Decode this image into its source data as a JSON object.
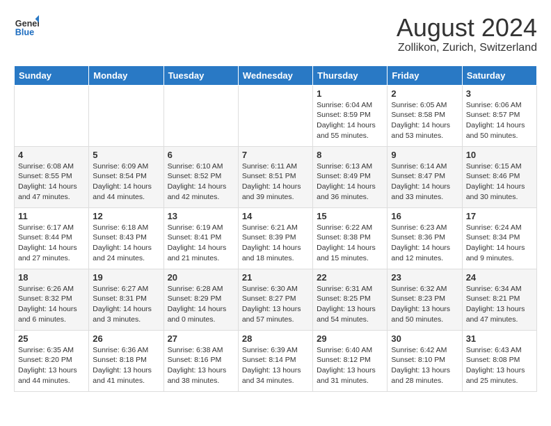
{
  "header": {
    "logo_line1": "General",
    "logo_line2": "Blue",
    "month_year": "August 2024",
    "location": "Zollikon, Zurich, Switzerland"
  },
  "days_of_week": [
    "Sunday",
    "Monday",
    "Tuesday",
    "Wednesday",
    "Thursday",
    "Friday",
    "Saturday"
  ],
  "weeks": [
    [
      {
        "num": "",
        "info": ""
      },
      {
        "num": "",
        "info": ""
      },
      {
        "num": "",
        "info": ""
      },
      {
        "num": "",
        "info": ""
      },
      {
        "num": "1",
        "info": "Sunrise: 6:04 AM\nSunset: 8:59 PM\nDaylight: 14 hours\nand 55 minutes."
      },
      {
        "num": "2",
        "info": "Sunrise: 6:05 AM\nSunset: 8:58 PM\nDaylight: 14 hours\nand 53 minutes."
      },
      {
        "num": "3",
        "info": "Sunrise: 6:06 AM\nSunset: 8:57 PM\nDaylight: 14 hours\nand 50 minutes."
      }
    ],
    [
      {
        "num": "4",
        "info": "Sunrise: 6:08 AM\nSunset: 8:55 PM\nDaylight: 14 hours\nand 47 minutes."
      },
      {
        "num": "5",
        "info": "Sunrise: 6:09 AM\nSunset: 8:54 PM\nDaylight: 14 hours\nand 44 minutes."
      },
      {
        "num": "6",
        "info": "Sunrise: 6:10 AM\nSunset: 8:52 PM\nDaylight: 14 hours\nand 42 minutes."
      },
      {
        "num": "7",
        "info": "Sunrise: 6:11 AM\nSunset: 8:51 PM\nDaylight: 14 hours\nand 39 minutes."
      },
      {
        "num": "8",
        "info": "Sunrise: 6:13 AM\nSunset: 8:49 PM\nDaylight: 14 hours\nand 36 minutes."
      },
      {
        "num": "9",
        "info": "Sunrise: 6:14 AM\nSunset: 8:47 PM\nDaylight: 14 hours\nand 33 minutes."
      },
      {
        "num": "10",
        "info": "Sunrise: 6:15 AM\nSunset: 8:46 PM\nDaylight: 14 hours\nand 30 minutes."
      }
    ],
    [
      {
        "num": "11",
        "info": "Sunrise: 6:17 AM\nSunset: 8:44 PM\nDaylight: 14 hours\nand 27 minutes."
      },
      {
        "num": "12",
        "info": "Sunrise: 6:18 AM\nSunset: 8:43 PM\nDaylight: 14 hours\nand 24 minutes."
      },
      {
        "num": "13",
        "info": "Sunrise: 6:19 AM\nSunset: 8:41 PM\nDaylight: 14 hours\nand 21 minutes."
      },
      {
        "num": "14",
        "info": "Sunrise: 6:21 AM\nSunset: 8:39 PM\nDaylight: 14 hours\nand 18 minutes."
      },
      {
        "num": "15",
        "info": "Sunrise: 6:22 AM\nSunset: 8:38 PM\nDaylight: 14 hours\nand 15 minutes."
      },
      {
        "num": "16",
        "info": "Sunrise: 6:23 AM\nSunset: 8:36 PM\nDaylight: 14 hours\nand 12 minutes."
      },
      {
        "num": "17",
        "info": "Sunrise: 6:24 AM\nSunset: 8:34 PM\nDaylight: 14 hours\nand 9 minutes."
      }
    ],
    [
      {
        "num": "18",
        "info": "Sunrise: 6:26 AM\nSunset: 8:32 PM\nDaylight: 14 hours\nand 6 minutes."
      },
      {
        "num": "19",
        "info": "Sunrise: 6:27 AM\nSunset: 8:31 PM\nDaylight: 14 hours\nand 3 minutes."
      },
      {
        "num": "20",
        "info": "Sunrise: 6:28 AM\nSunset: 8:29 PM\nDaylight: 14 hours\nand 0 minutes."
      },
      {
        "num": "21",
        "info": "Sunrise: 6:30 AM\nSunset: 8:27 PM\nDaylight: 13 hours\nand 57 minutes."
      },
      {
        "num": "22",
        "info": "Sunrise: 6:31 AM\nSunset: 8:25 PM\nDaylight: 13 hours\nand 54 minutes."
      },
      {
        "num": "23",
        "info": "Sunrise: 6:32 AM\nSunset: 8:23 PM\nDaylight: 13 hours\nand 50 minutes."
      },
      {
        "num": "24",
        "info": "Sunrise: 6:34 AM\nSunset: 8:21 PM\nDaylight: 13 hours\nand 47 minutes."
      }
    ],
    [
      {
        "num": "25",
        "info": "Sunrise: 6:35 AM\nSunset: 8:20 PM\nDaylight: 13 hours\nand 44 minutes."
      },
      {
        "num": "26",
        "info": "Sunrise: 6:36 AM\nSunset: 8:18 PM\nDaylight: 13 hours\nand 41 minutes."
      },
      {
        "num": "27",
        "info": "Sunrise: 6:38 AM\nSunset: 8:16 PM\nDaylight: 13 hours\nand 38 minutes."
      },
      {
        "num": "28",
        "info": "Sunrise: 6:39 AM\nSunset: 8:14 PM\nDaylight: 13 hours\nand 34 minutes."
      },
      {
        "num": "29",
        "info": "Sunrise: 6:40 AM\nSunset: 8:12 PM\nDaylight: 13 hours\nand 31 minutes."
      },
      {
        "num": "30",
        "info": "Sunrise: 6:42 AM\nSunset: 8:10 PM\nDaylight: 13 hours\nand 28 minutes."
      },
      {
        "num": "31",
        "info": "Sunrise: 6:43 AM\nSunset: 8:08 PM\nDaylight: 13 hours\nand 25 minutes."
      }
    ]
  ]
}
